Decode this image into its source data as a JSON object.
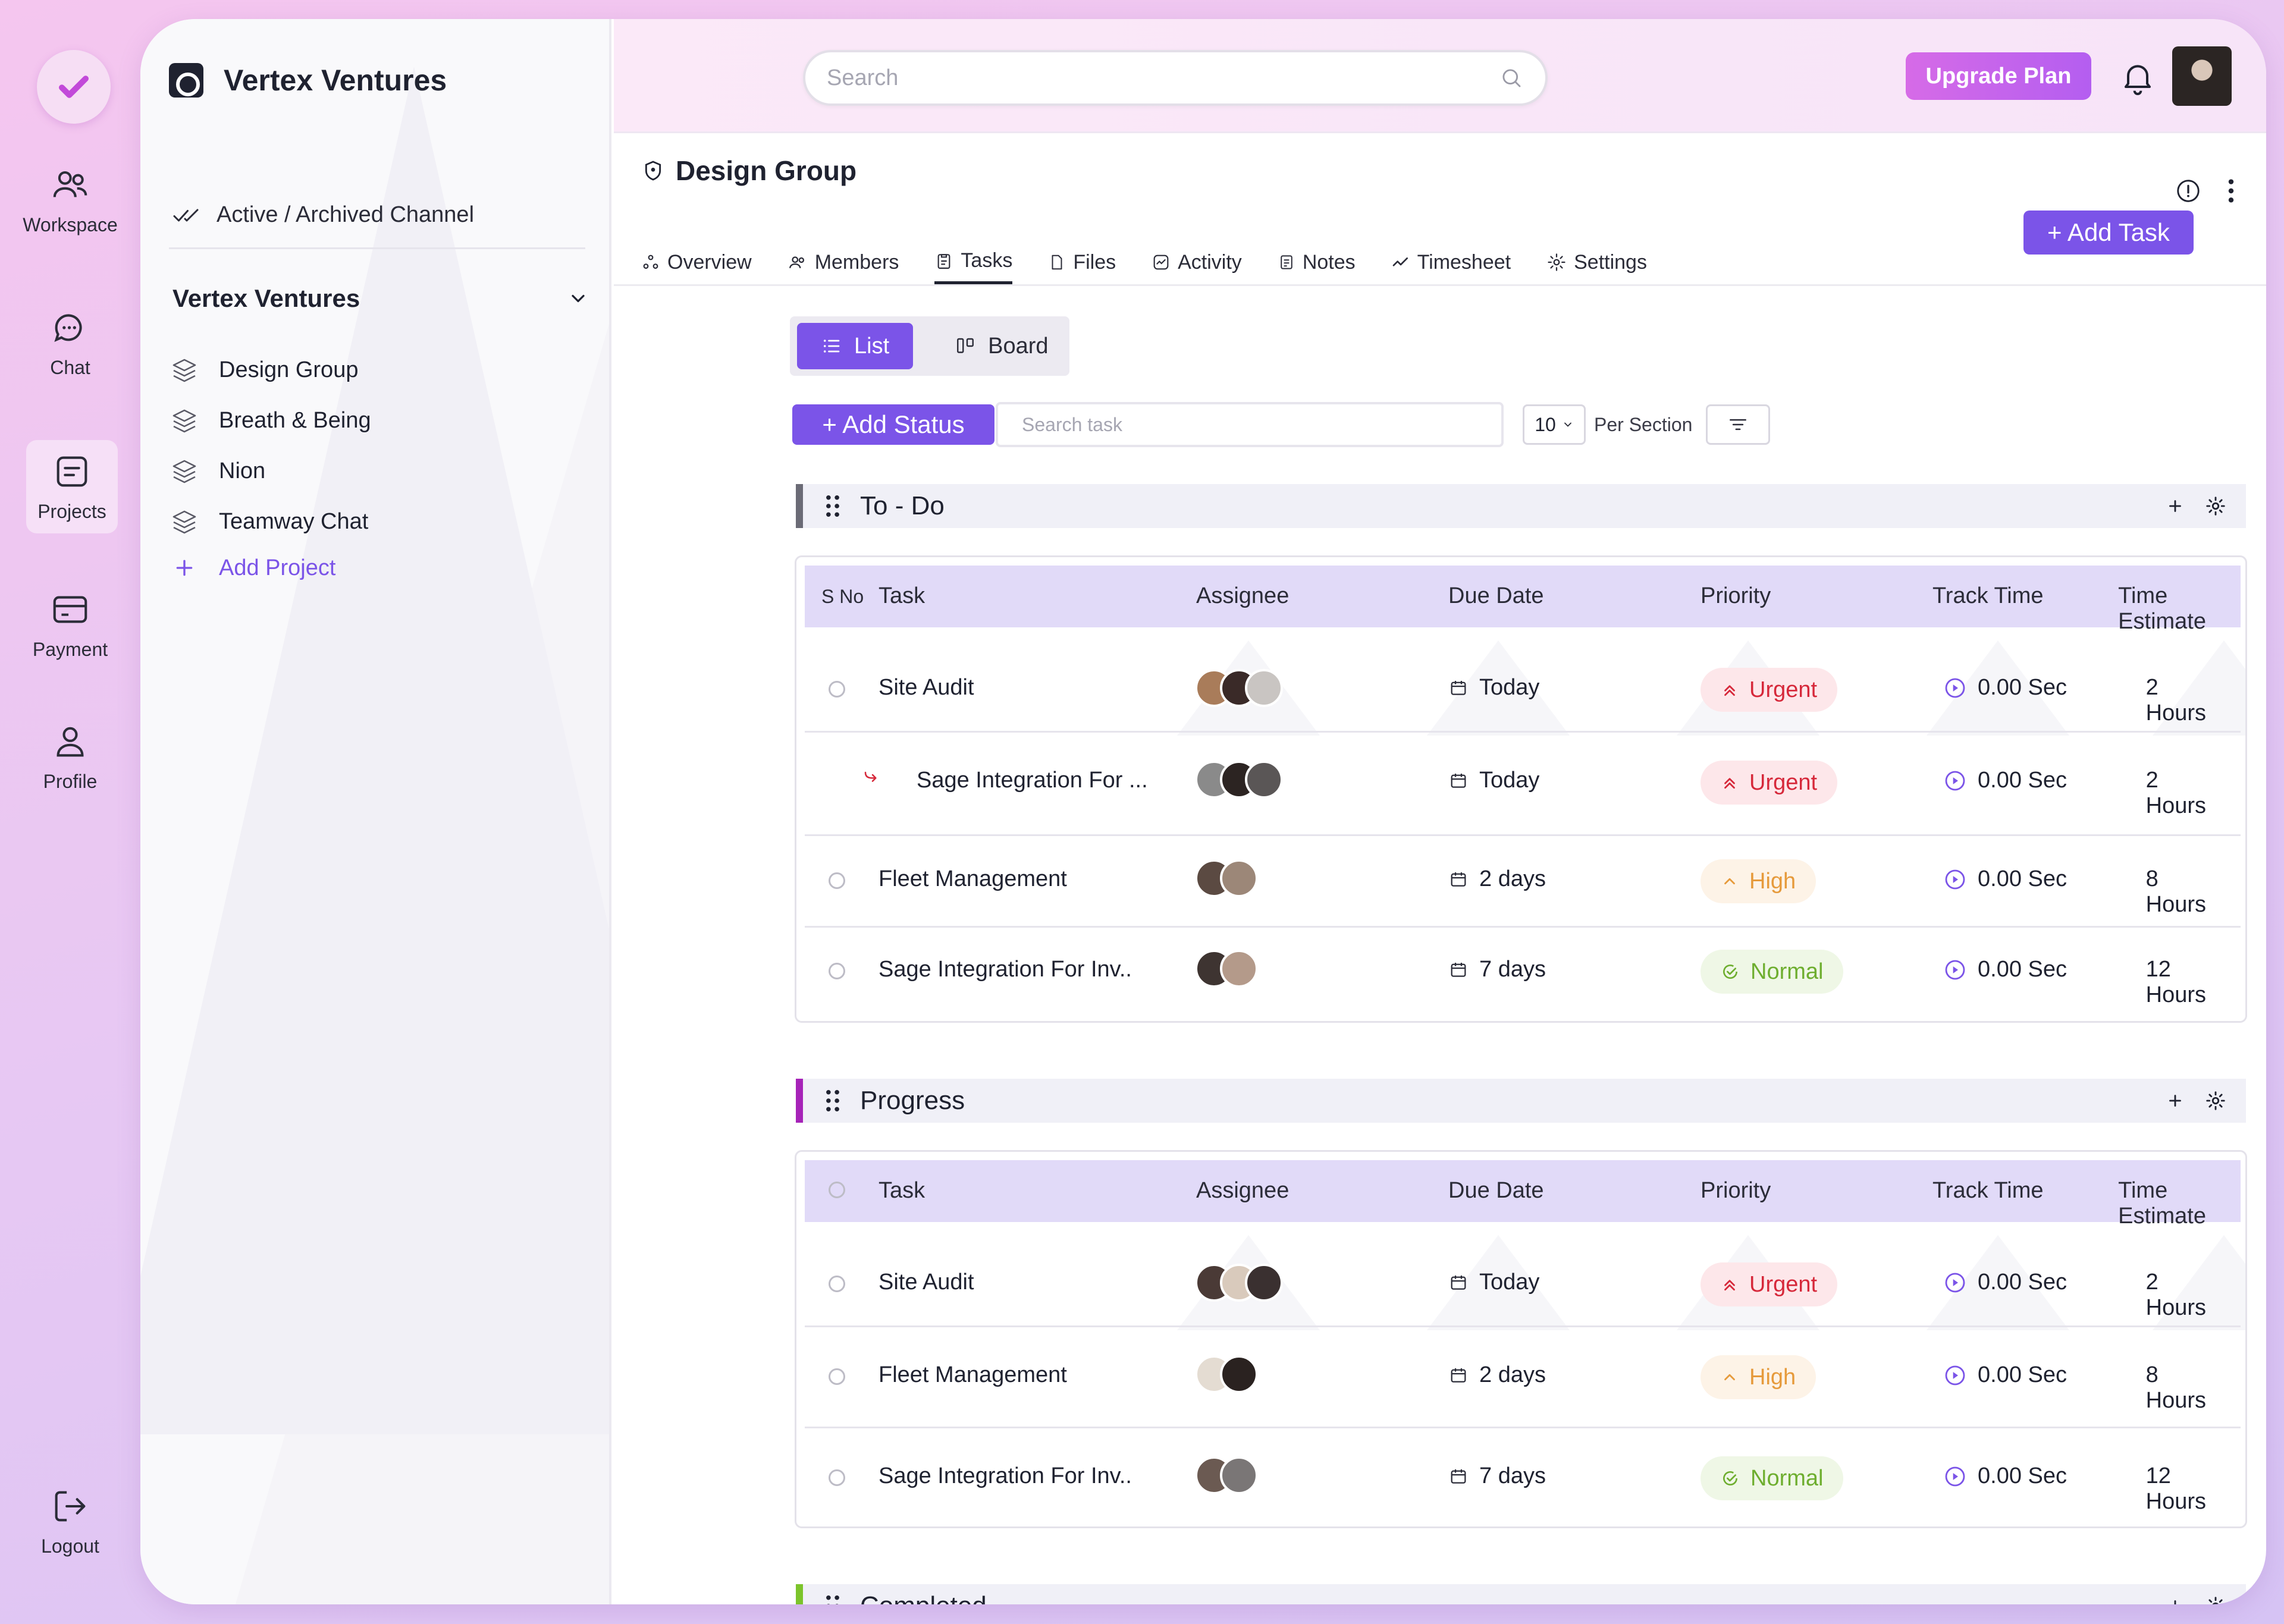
{
  "rail": {
    "items": [
      {
        "label": "Workspace",
        "icon": "users-icon"
      },
      {
        "label": "Chat",
        "icon": "chat-icon"
      },
      {
        "label": "Projects",
        "icon": "projects-icon",
        "active": true
      },
      {
        "label": "Payment",
        "icon": "card-icon"
      },
      {
        "label": "Profile",
        "icon": "user-icon"
      }
    ],
    "logout": "Logout"
  },
  "sidebar": {
    "brand": "Vertex Ventures",
    "archived": "Active / Archived Channel",
    "section": "Vertex Ventures",
    "projects": [
      "Design Group",
      "Breath & Being",
      "Nion",
      "Teamway Chat"
    ],
    "add_project": "Add Project"
  },
  "topbar": {
    "search_placeholder": "Search",
    "upgrade": "Upgrade Plan"
  },
  "page": {
    "title": "Design Group",
    "tabs": [
      "Overview",
      "Members",
      "Tasks",
      "Files",
      "Activity",
      "Notes",
      "Timesheet",
      "Settings"
    ],
    "active_tab": "Tasks",
    "add_task": "+ Add Task",
    "view_list": "List",
    "view_board": "Board",
    "add_status": "+ Add Status",
    "search_task_placeholder": "Search task",
    "per_value": "10",
    "per_label": "Per Section"
  },
  "columns": {
    "sno": "S No",
    "task": "Task",
    "assignee": "Assignee",
    "due": "Due Date",
    "priority": "Priority",
    "track": "Track Time",
    "estimate": "Time Estimate"
  },
  "sections": [
    {
      "title": "To - Do",
      "color": "#6b6b76",
      "rows": [
        {
          "task": "Site Audit",
          "due": "Today",
          "priority": "Urgent",
          "track": "0.00 Sec",
          "estimate": "2 Hours",
          "subtask": false
        },
        {
          "task": "Sage Integration For ...",
          "due": "Today",
          "priority": "Urgent",
          "track": "0.00 Sec",
          "estimate": "2 Hours",
          "subtask": true
        },
        {
          "task": "Fleet Management",
          "due": "2 days",
          "priority": "High",
          "track": "0.00 Sec",
          "estimate": "8 Hours",
          "subtask": false
        },
        {
          "task": "Sage Integration For Inv..",
          "due": "7 days",
          "priority": "Normal",
          "track": "0.00 Sec",
          "estimate": "12 Hours",
          "subtask": false
        }
      ]
    },
    {
      "title": "Progress",
      "color": "#a623b8",
      "rows": [
        {
          "task": "Site Audit",
          "due": "Today",
          "priority": "Urgent",
          "track": "0.00 Sec",
          "estimate": "2 Hours"
        },
        {
          "task": "Fleet Management",
          "due": "2 days",
          "priority": "High",
          "track": "0.00 Sec",
          "estimate": "8 Hours"
        },
        {
          "task": "Sage Integration For Inv..",
          "due": "7 days",
          "priority": "Normal",
          "track": "0.00 Sec",
          "estimate": "12 Hours"
        }
      ]
    },
    {
      "title": "Completed",
      "color": "#7cc42b"
    }
  ],
  "colors": {
    "accent": "#7b54e8",
    "urgent": "#d6283a",
    "high": "#e69a3b",
    "normal": "#6eae2f"
  }
}
